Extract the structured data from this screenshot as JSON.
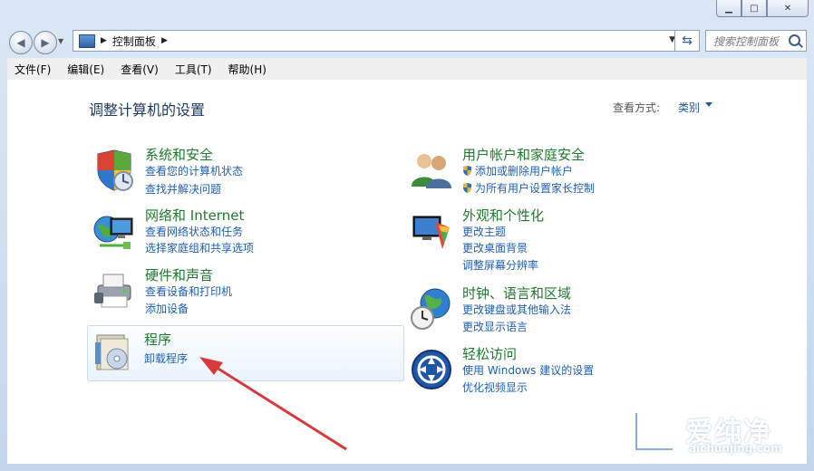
{
  "window": {
    "controls": {
      "min": "▁",
      "max": "□",
      "close": "✕"
    }
  },
  "address": {
    "crumb": "控制面板",
    "search_placeholder": "搜索控制面板"
  },
  "menu": [
    "文件(F)",
    "编辑(E)",
    "查看(V)",
    "工具(T)",
    "帮助(H)"
  ],
  "content": {
    "title": "调整计算机的设置",
    "view_label": "查看方式:",
    "view_value": "类别"
  },
  "categories": [
    {
      "title": "系统和安全",
      "links": [
        "查看您的计算机状态",
        "查找并解决问题"
      ],
      "icon": "shield-icon"
    },
    {
      "title": "网络和 Internet",
      "links": [
        "查看网络状态和任务",
        "选择家庭组和共享选项"
      ],
      "icon": "network-icon"
    },
    {
      "title": "硬件和声音",
      "links": [
        "查看设备和打印机",
        "添加设备"
      ],
      "icon": "printer-icon"
    },
    {
      "title": "程序",
      "links": [
        "卸载程序"
      ],
      "icon": "programs-icon"
    },
    {
      "title": "用户帐户和家庭安全",
      "links": [
        "添加或删除用户帐户",
        "为所有用户设置家长控制"
      ],
      "icon": "users-icon"
    },
    {
      "title": "外观和个性化",
      "links": [
        "更改主题",
        "更改桌面背景",
        "调整屏幕分辨率"
      ],
      "icon": "appearance-icon"
    },
    {
      "title": "时钟、语言和区域",
      "links": [
        "更改键盘或其他输入法",
        "更改显示语言"
      ],
      "icon": "globe-clock-icon"
    },
    {
      "title": "轻松访问",
      "links": [
        "使用 Windows 建议的设置",
        "优化视频显示"
      ],
      "icon": "ease-of-access-icon"
    }
  ],
  "watermark": {
    "text": "爱纯净",
    "url": "aichunjing.com"
  },
  "colors": {
    "title_green": "#1e7a2e",
    "link_blue": "#1d5fb7",
    "arrow_red": "#d9393b"
  }
}
